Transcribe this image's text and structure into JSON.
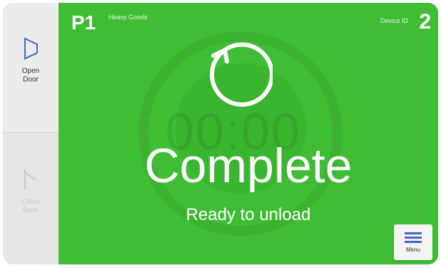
{
  "sidebar": {
    "open_door_label": "Open\nDoor",
    "disabled_button_label": "Close\nDoor",
    "footer_text": ""
  },
  "header": {
    "program_id": "P1",
    "program_name": "Heavy Goods",
    "device_label": "Device ID",
    "device_id": "2"
  },
  "status": {
    "title": "Complete",
    "subtitle": "Ready to unload",
    "background_time": "00:00"
  },
  "menu": {
    "label": "Menu"
  },
  "colors": {
    "accent_green": "#3fbd34",
    "icon_blue": "#4a66c9"
  }
}
